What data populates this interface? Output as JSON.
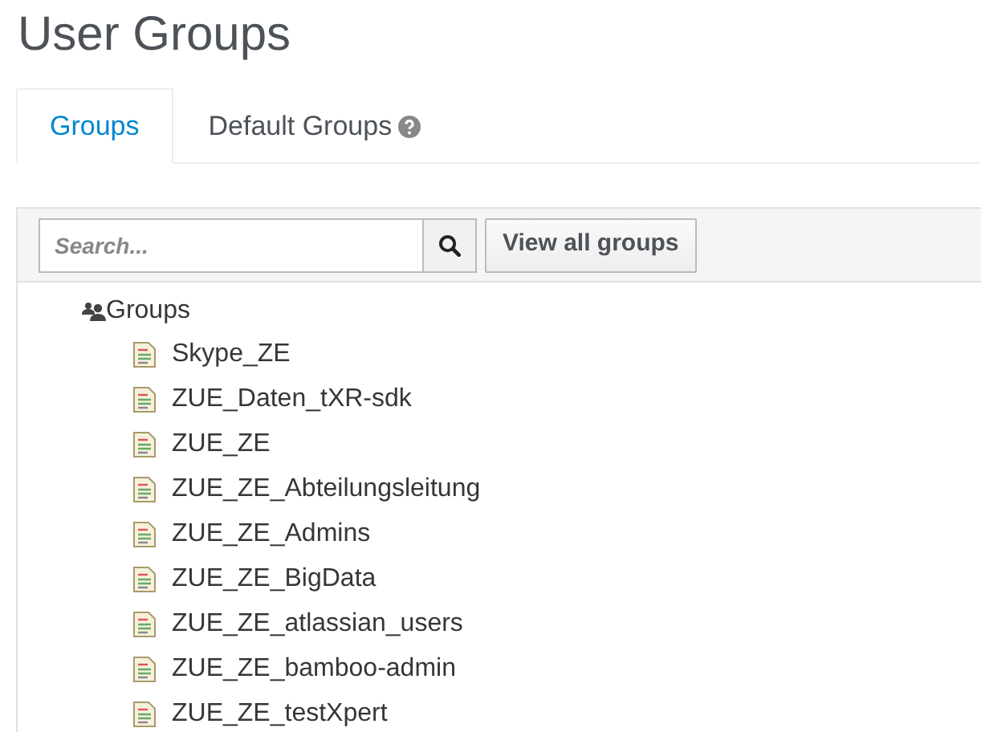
{
  "title": "User Groups",
  "tabs": [
    {
      "label": "Groups",
      "selected": true,
      "help": false
    },
    {
      "label": "Default Groups",
      "selected": false,
      "help": true
    }
  ],
  "toolbar": {
    "search": {
      "placeholder": "Search..."
    },
    "view_all_button": "View all groups"
  },
  "tree": {
    "label": "Groups",
    "children": [
      {
        "label": "Skype_ZE"
      },
      {
        "label": "ZUE_Daten_tXR-sdk"
      },
      {
        "label": "ZUE_ZE"
      },
      {
        "label": "ZUE_ZE_Abteilungsleitung"
      },
      {
        "label": "ZUE_ZE_Admins"
      },
      {
        "label": "ZUE_ZE_BigData"
      },
      {
        "label": "ZUE_ZE_atlassian_users"
      },
      {
        "label": "ZUE_ZE_bamboo-admin"
      },
      {
        "label": "ZUE_ZE_testXpert"
      }
    ]
  }
}
